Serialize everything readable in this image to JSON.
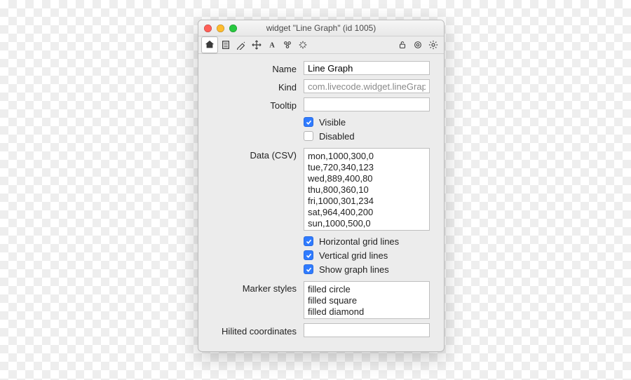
{
  "window": {
    "title": "widget \"Line Graph\" (id 1005)"
  },
  "labels": {
    "name": "Name",
    "kind": "Kind",
    "tooltip": "Tooltip",
    "data": "Data (CSV)",
    "markerStyles": "Marker styles",
    "hilited": "Hilited coordinates"
  },
  "fields": {
    "name": "Line Graph",
    "kind": "com.livecode.widget.lineGraph",
    "tooltip": "",
    "data": "mon,1000,300,0\ntue,720,340,123\nwed,889,400,80\nthu,800,360,10\nfri,1000,301,234\nsat,964,400,200\nsun,1000,500,0",
    "markerStyles": "filled circle\nfilled square\nfilled diamond",
    "hilited": ""
  },
  "checks": {
    "visible": "Visible",
    "disabled": "Disabled",
    "hgrid": "Horizontal grid lines",
    "vgrid": "Vertical grid lines",
    "showLines": "Show graph lines"
  }
}
